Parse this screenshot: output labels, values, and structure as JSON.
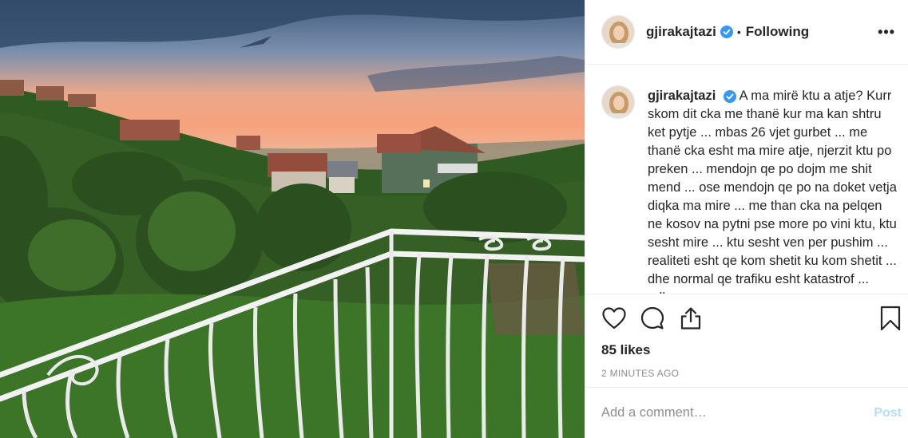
{
  "post": {
    "username": "gjirakajtazi",
    "follow_separator": "•",
    "follow_status": "Following",
    "more_label": "•••",
    "caption": "A ma mirë ktu a atje? Kurr skom dit cka me thanë kur ma kan shtru ket pytje ... mbas 26 vjet gurbet ... me thanë cka esht ma mire atje, njerzit ktu po preken ... mendojn qe po dojm me shit mend ... ose mendojn qe po na doket vetja diqka ma mire ... me than cka na pelqen ne kosov na pytni pse more po vini ktu, ktu sesht mire ... ktu sesht ven per pushim ... realiteti esht qe kom shetit ku kom shetit ... dhe normal qe trafiku esht katastrof ... edhe",
    "likes": "85 likes",
    "timestamp": "2 MINUTES AGO"
  },
  "comment": {
    "placeholder": "Add a comment…",
    "post_label": "Post"
  },
  "icons": {
    "like": "heart-icon",
    "comment": "comment-bubble-icon",
    "share": "share-icon",
    "save": "bookmark-icon",
    "verified": "verified-badge-icon"
  },
  "colors": {
    "verified": "#3897f0",
    "post_button_disabled": "#b2dffc",
    "muted_text": "#8e8e8e"
  }
}
